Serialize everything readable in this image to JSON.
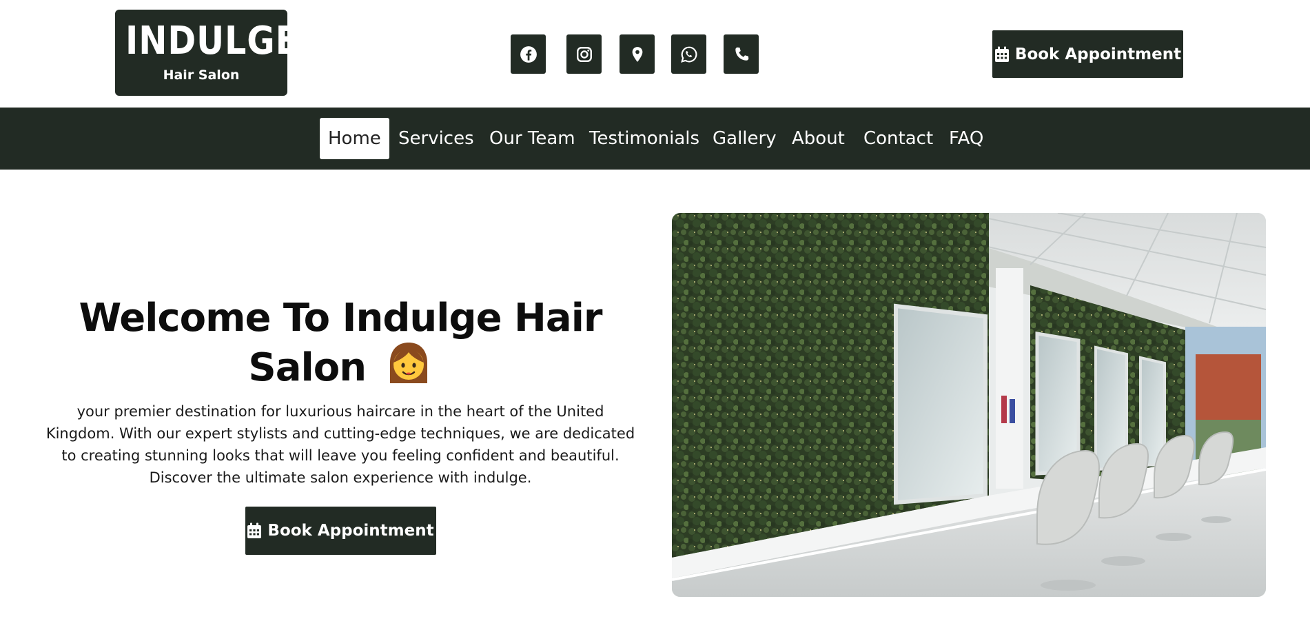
{
  "logo": {
    "title": "INDULGE",
    "subtitle": "Hair Salon"
  },
  "social_links": [
    {
      "icon": "facebook-icon"
    },
    {
      "icon": "instagram-icon"
    },
    {
      "icon": "map-pin-icon"
    },
    {
      "icon": "whatsapp-icon"
    },
    {
      "icon": "phone-icon"
    }
  ],
  "header": {
    "book_label": "Book Appointment",
    "book_icon": "calendar-icon"
  },
  "nav": {
    "items": [
      {
        "label": "Home",
        "active": true
      },
      {
        "label": "Services"
      },
      {
        "label": "Our Team"
      },
      {
        "label": "Testimonials"
      },
      {
        "label": "Gallery"
      },
      {
        "label": "About"
      },
      {
        "label": "Contact"
      },
      {
        "label": "FAQ"
      }
    ]
  },
  "hero": {
    "title": "Welcome To Indulge Hair Salon",
    "title_emoji": "woman-emoji",
    "description": "your premier destination for luxurious haircare in the heart of the United Kingdom. With our expert stylists and cutting-edge techniques, we are dedicated to creating stunning looks that will leave you feeling confident and beautiful. Discover the ultimate salon experience with indulge.",
    "book_label": "Book Appointment",
    "image_subject": "salon-interior-photo"
  },
  "colors": {
    "brand_dark": "#222b24",
    "background": "#ffffff",
    "text": "#0d0d0d"
  }
}
